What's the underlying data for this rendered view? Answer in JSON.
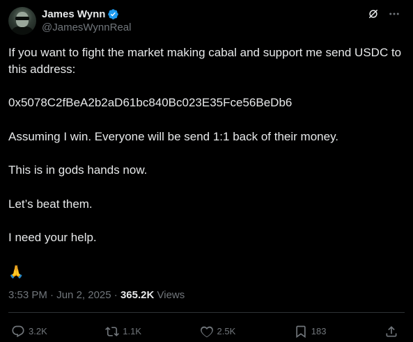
{
  "author": {
    "display_name": "James Wynn",
    "handle": "@JamesWynnReal",
    "verified": true,
    "verified_color": "#1d9bf0"
  },
  "tweet": {
    "paragraphs": [
      "If you want to fight the market making cabal and support me send USDC to this address:",
      "0x5078C2fBeA2b2aD61bc840Bc023E35Fce56BeDb6",
      "Assuming I win. Everyone will be send 1:1 back of their money.",
      "This is in gods hands now.",
      "Let’s beat them.",
      "I need your help.",
      "🙏"
    ]
  },
  "meta": {
    "time": "3:53 PM",
    "separator": "·",
    "date": "Jun 2, 2025",
    "views_count": "365.2K",
    "views_label": "Views"
  },
  "actions": {
    "replies": "3.2K",
    "reposts": "1.1K",
    "likes": "2.5K",
    "bookmarks": "183"
  },
  "icons": {
    "grok": "grok-icon",
    "more": "more-icon",
    "reply": "reply-icon",
    "repost": "repost-icon",
    "like": "heart-icon",
    "bookmark": "bookmark-icon",
    "share": "share-icon"
  },
  "colors": {
    "background": "#000000",
    "text": "#e7e9ea",
    "muted": "#71767b",
    "border": "#2f3336"
  }
}
